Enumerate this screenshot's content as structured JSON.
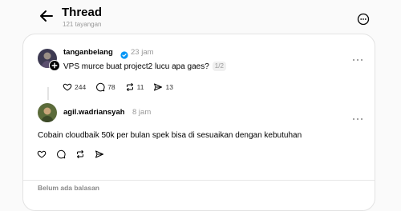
{
  "header": {
    "title": "Thread",
    "views": "121 tayangan"
  },
  "original_post": {
    "username": "tanganbelang",
    "verified": true,
    "time": "23 jam",
    "text": "VPS murce buat project2 lucu apa gaes?",
    "pager": "1/2",
    "likes": "244",
    "comments": "78",
    "reposts": "11",
    "shares": "13"
  },
  "reply": {
    "username": "agil.wadriansyah",
    "time": "8 jam",
    "text": "Cobain cloudbaik 50k per bulan spek bisa di sesuaikan dengan kebutuhan"
  },
  "empty_replies": "Belum ada balasan",
  "colors": {
    "verified": "#0095f6",
    "muted": "#999999",
    "border": "#e3e3e3"
  },
  "icons": [
    "back-arrow-icon",
    "more-circle-icon",
    "verified-badge-icon",
    "follow-plus-icon",
    "more-dots-icon",
    "heart-icon",
    "comment-icon",
    "repost-icon",
    "share-icon"
  ]
}
